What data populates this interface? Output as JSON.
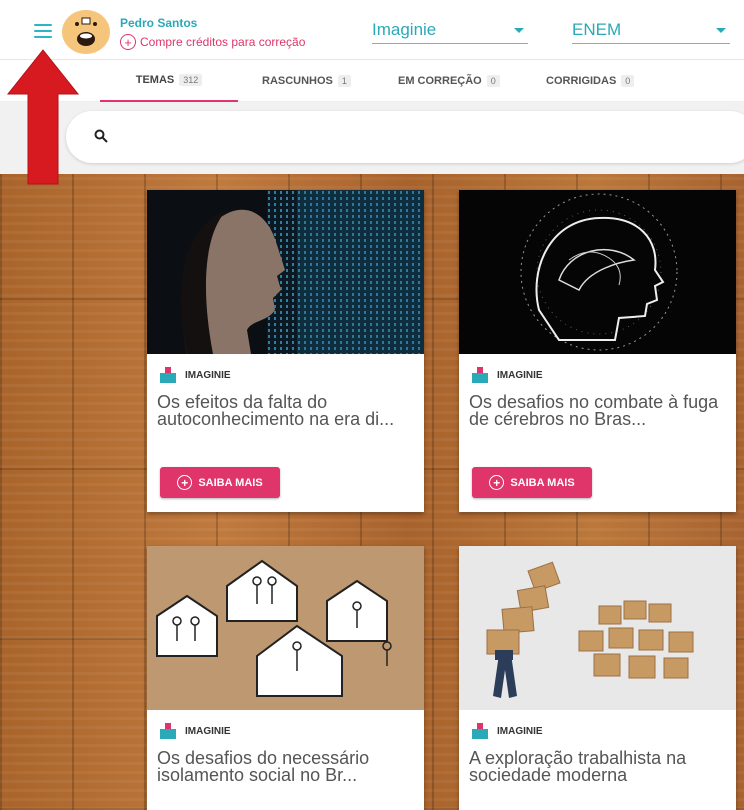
{
  "header": {
    "user_name": "Pedro Santos",
    "credits_text": "Compre créditos para correção",
    "select_publisher": "Imaginie",
    "select_exam": "ENEM"
  },
  "tabs": [
    {
      "label": "TEMAS",
      "count": "312"
    },
    {
      "label": "RASCUNHOS",
      "count": "1"
    },
    {
      "label": "EM CORREÇÃO",
      "count": "0"
    },
    {
      "label": "CORRIGIDAS",
      "count": "0"
    }
  ],
  "cards": [
    {
      "brand": "IMAGINIE",
      "title": "Os efeitos da falta do autoconhecimento na era di...",
      "cta": "SAIBA MAIS"
    },
    {
      "brand": "IMAGINIE",
      "title": "Os desafios no combate à fuga de cérebros no Bras...",
      "cta": "SAIBA MAIS"
    },
    {
      "brand": "IMAGINIE",
      "title": "Os desafios do necessário isolamento social no Br..."
    },
    {
      "brand": "IMAGINIE",
      "title": "A exploração trabalhista na sociedade moderna"
    }
  ],
  "colors": {
    "accent_teal": "#2aa9b8",
    "accent_pink": "#e0356a",
    "annotation_red": "#d71920"
  },
  "icons": [
    "menu-icon",
    "search-icon",
    "plus-circle-icon",
    "imaginie-logo-icon",
    "caret-down-icon"
  ]
}
